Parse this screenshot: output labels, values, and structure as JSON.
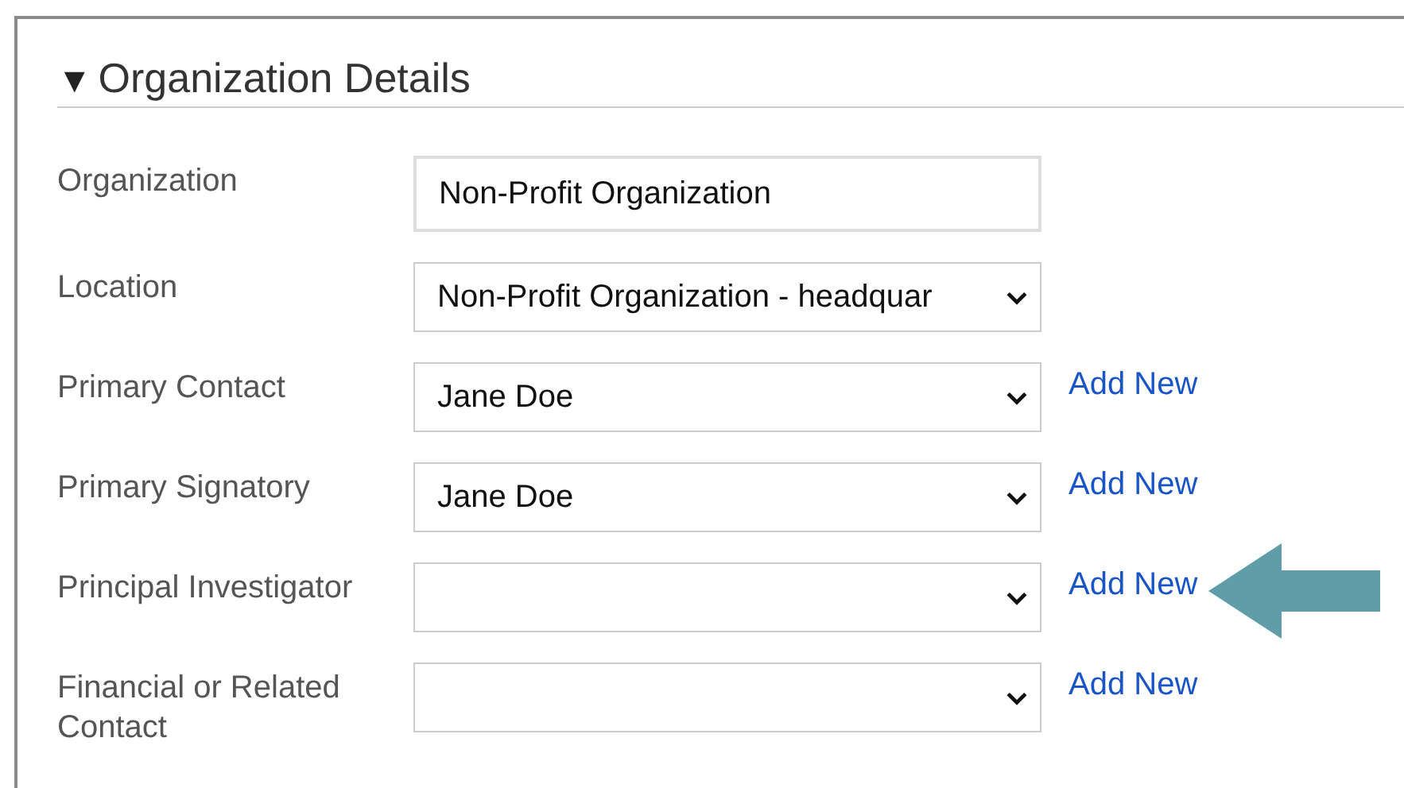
{
  "section": {
    "toggle": "▼",
    "title": "Organization Details"
  },
  "fields": [
    {
      "label": "Organization",
      "kind": "text",
      "value": "Non-Profit Organization"
    },
    {
      "label": "Location",
      "kind": "select",
      "value": "Non-Profit Organization - headquar"
    },
    {
      "label": "Primary Contact",
      "kind": "select",
      "value": "Jane Doe",
      "link": "Add New",
      "pointed": false
    },
    {
      "label": "Primary Signatory",
      "kind": "select",
      "value": "Jane Doe",
      "link": "Add New",
      "pointed": false
    },
    {
      "label": "Principal Investigator",
      "kind": "select",
      "link": "Add New",
      "pointed": true
    },
    {
      "label": "Financial or Related Contact",
      "kind": "select",
      "link": "Add New",
      "pointed": false
    }
  ]
}
